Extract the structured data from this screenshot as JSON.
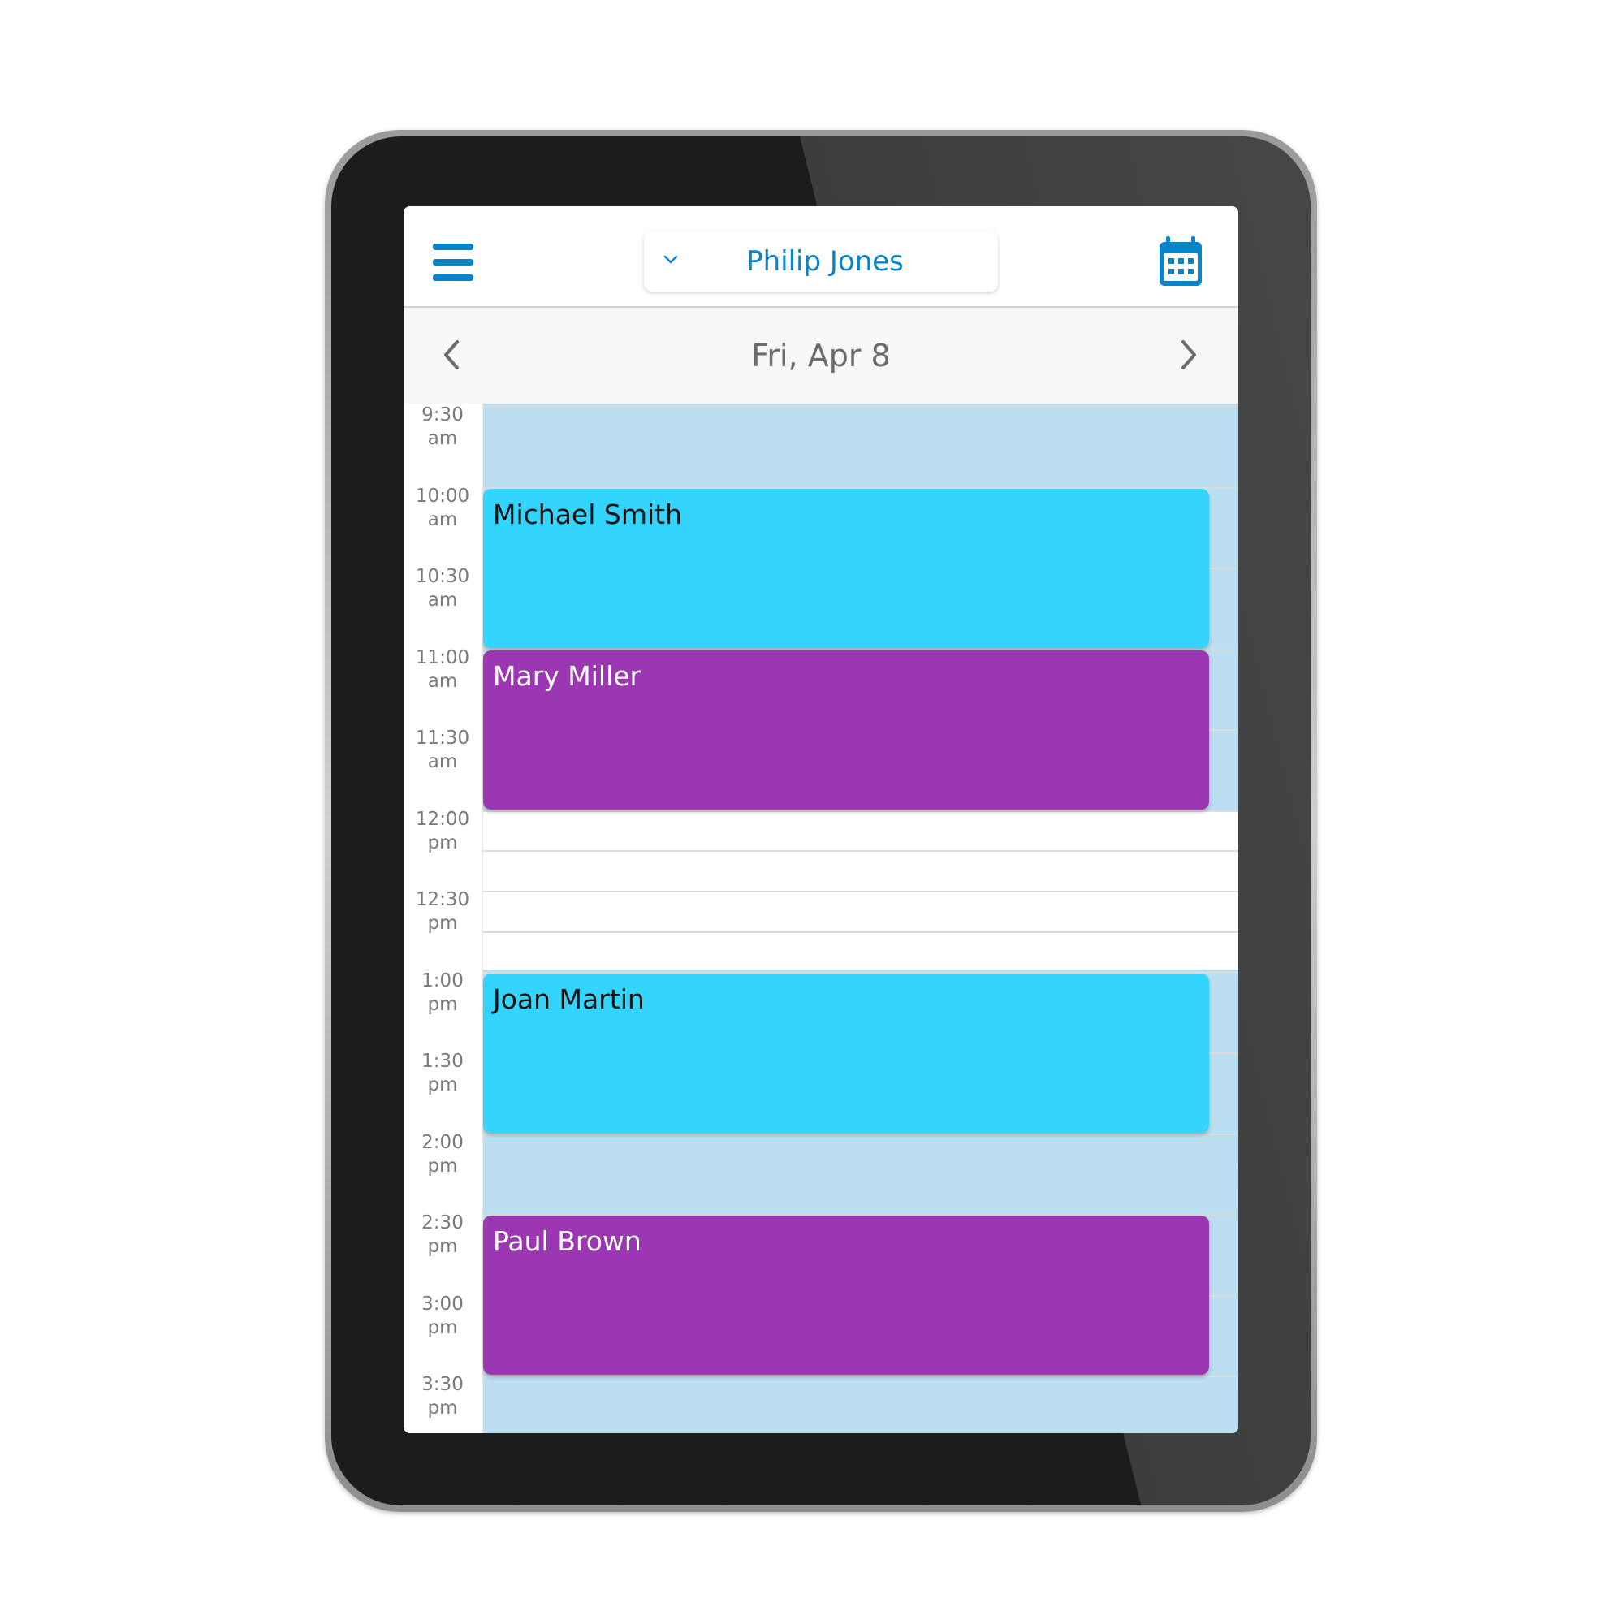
{
  "header": {
    "menu_icon": "hamburger-menu-icon",
    "selected_user": "Philip Jones",
    "dropdown_icon": "chevron-down-icon",
    "calendar_icon": "calendar-icon"
  },
  "datebar": {
    "prev_icon": "chevron-left-icon",
    "date": "Fri, Apr 8",
    "next_icon": "chevron-right-icon"
  },
  "time_slots": [
    {
      "time": "9:30",
      "period": "am"
    },
    {
      "time": "10:00",
      "period": "am"
    },
    {
      "time": "10:30",
      "period": "am"
    },
    {
      "time": "11:00",
      "period": "am"
    },
    {
      "time": "11:30",
      "period": "am"
    },
    {
      "time": "12:00",
      "period": "pm"
    },
    {
      "time": "12:30",
      "period": "pm"
    },
    {
      "time": "1:00",
      "period": "pm"
    },
    {
      "time": "1:30",
      "period": "pm"
    },
    {
      "time": "2:00",
      "period": "pm"
    },
    {
      "time": "2:30",
      "period": "pm"
    },
    {
      "time": "3:00",
      "period": "pm"
    },
    {
      "time": "3:30",
      "period": "pm"
    }
  ],
  "availability": [
    {
      "start": "9:30",
      "end": "12:00",
      "available": true
    },
    {
      "start": "12:00",
      "end": "13:00",
      "available": false
    },
    {
      "start": "13:00",
      "end": "16:00",
      "available": true
    }
  ],
  "events": [
    {
      "name": "Michael Smith",
      "start": "10:00",
      "end": "11:00",
      "color": "#33d4fd",
      "text_color": "#111111"
    },
    {
      "name": "Mary Miller",
      "start": "11:00",
      "end": "12:00",
      "color": "#9c37b3",
      "text_color": "#ffffff"
    },
    {
      "name": "Joan Martin",
      "start": "13:00",
      "end": "14:00",
      "color": "#33d4fd",
      "text_color": "#111111"
    },
    {
      "name": "Paul Brown",
      "start": "14:30",
      "end": "15:30",
      "color": "#9c37b3",
      "text_color": "#ffffff"
    }
  ],
  "colors": {
    "accent": "#0a84c9",
    "available_band": "#bbdef0"
  }
}
